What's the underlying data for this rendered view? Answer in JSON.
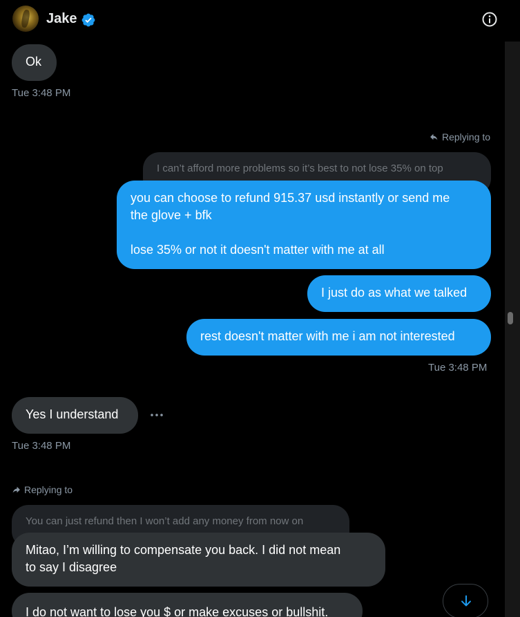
{
  "header": {
    "name": "Jake",
    "avatar_icon": "avatar",
    "verified_icon": "verified-badge-icon",
    "info_icon": "info-icon"
  },
  "colors": {
    "background": "#000000",
    "incoming_bubble": "#2f3336",
    "outgoing_bubble": "#1d9bf0",
    "quote_bubble": "#202327",
    "muted_text": "#8b98a5",
    "verified": "#1d9bf0"
  },
  "messages": {
    "m1": {
      "text": "Ok",
      "time": "Tue 3:48 PM"
    },
    "reply1": {
      "label": "Replying to",
      "quote": "I can’t afford more problems so it’s best to not lose 35% on top"
    },
    "m2": {
      "line1": "you can choose to refund 915.37 usd instantly or send me",
      "line2": "the glove + bfk",
      "line3": "lose 35% or not it doesn't matter with me at all"
    },
    "m3": {
      "text": "I just do as what we talked"
    },
    "m4": {
      "text": "rest doesn't matter with me i am not interested",
      "time": "Tue 3:48 PM"
    },
    "m5": {
      "text": "Yes I understand",
      "time": "Tue 3:48 PM"
    },
    "reply2": {
      "label": "Replying to",
      "quote": "You can just refund then I won’t add any money from now on"
    },
    "m6": {
      "line1": "Mitao, I’m willing to compensate you back. I did not mean",
      "line2": "to say I disagree"
    },
    "m7": {
      "text": "I do not want to lose you $ or make excuses or bullshit."
    }
  }
}
